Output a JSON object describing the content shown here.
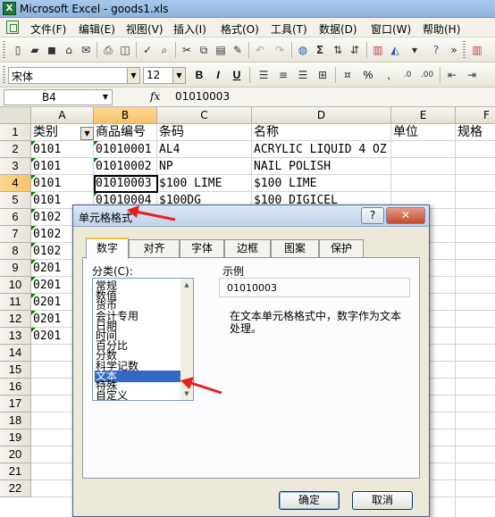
{
  "window": {
    "title": "Microsoft Excel - goods1.xls"
  },
  "menu": [
    "文件(F)",
    "编辑(E)",
    "视图(V)",
    "插入(I)",
    "格式(O)",
    "工具(T)",
    "数据(D)",
    "窗口(W)",
    "帮助(H)"
  ],
  "format_toolbar": {
    "font_name": "宋体",
    "font_size": "12",
    "bold": "B",
    "italic": "I",
    "underline": "U",
    "percent": "%",
    "comma": ","
  },
  "formula_bar": {
    "name_box": "B4",
    "fx": "fx",
    "value": "01010003"
  },
  "columns": [
    "A",
    "B",
    "C",
    "D",
    "E",
    "F"
  ],
  "rows": [
    "1",
    "2",
    "3",
    "4",
    "5",
    "6",
    "7",
    "8",
    "9",
    "10",
    "11",
    "12",
    "13",
    "14",
    "15",
    "16",
    "17",
    "18",
    "19",
    "20",
    "21",
    "22"
  ],
  "sheet": {
    "header": [
      "类别",
      "商品编号",
      "条码",
      "名称",
      "单位",
      "规格"
    ],
    "data": [
      [
        "0101",
        "01010001",
        "AL4",
        "ACRYLIC LIQUID 4 OZ"
      ],
      [
        "0101",
        "01010002",
        "NP",
        "NAIL POLISH"
      ],
      [
        "0101",
        "01010003",
        "$100 LIME",
        "$100 LIME"
      ],
      [
        "0101",
        "01010004",
        "$100DG",
        "$100 DIGICEL"
      ],
      [
        "0102"
      ],
      [
        "0102"
      ],
      [
        "0102"
      ],
      [
        "0201"
      ],
      [
        "0201"
      ],
      [
        "0201"
      ],
      [
        "0201"
      ],
      [
        "0201"
      ]
    ]
  },
  "dialog": {
    "title": "单元格格式",
    "help": "?",
    "close": "✕",
    "tabs": [
      "数字",
      "对齐",
      "字体",
      "边框",
      "图案",
      "保护"
    ],
    "active_tab": "数字",
    "category_label": "分类(C):",
    "categories": [
      "常规",
      "数值",
      "货币",
      "会计专用",
      "日期",
      "时间",
      "百分比",
      "分数",
      "科学记数",
      "文本",
      "特殊",
      "自定义"
    ],
    "selected_category": "文本",
    "sample_label": "示例",
    "sample_value": "01010003",
    "description": "在文本单元格格式中，数字作为文本处理。",
    "ok": "确定",
    "cancel": "取消"
  },
  "colors": {
    "arrow": "#e8201f",
    "selection": "#316ac5",
    "active_tab_border": "#f5c03f"
  }
}
